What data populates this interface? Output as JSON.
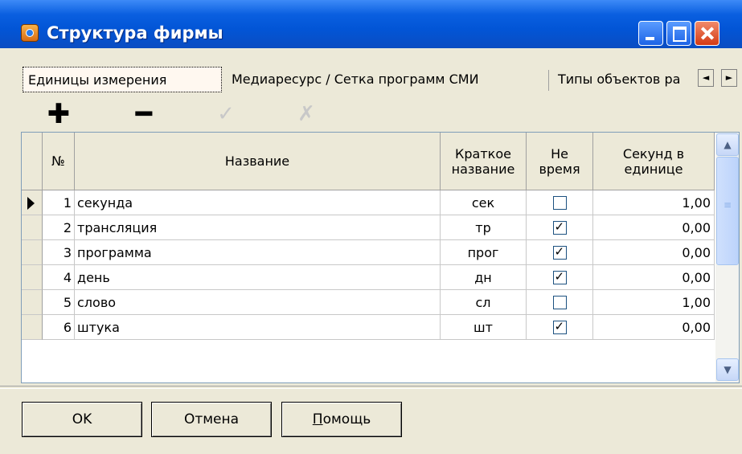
{
  "window": {
    "title": "Структура фирмы",
    "icon": "app-icon",
    "controls": [
      "minimize-icon",
      "maximize-icon",
      "close-icon"
    ]
  },
  "tabs": [
    {
      "label": "Единицы измерения",
      "active": true
    },
    {
      "label": "Медиаресурс / Сетка программ СМИ",
      "active": false
    },
    {
      "label": "Типы объектов ра",
      "active": false
    }
  ],
  "tab_scroll": {
    "left": "◄",
    "right": "►"
  },
  "toolbar": {
    "add": "✚",
    "remove": "━",
    "confirm": "✓",
    "cancel": "✗"
  },
  "grid": {
    "columns": {
      "num": "№",
      "name": "Название",
      "short": "Краткое название",
      "notime": "Не время",
      "seconds": "Секунд в единице"
    },
    "rows": [
      {
        "num": "1",
        "name": "секунда",
        "short": "сек",
        "notime": false,
        "seconds": "1,00"
      },
      {
        "num": "2",
        "name": "трансляция",
        "short": "тр",
        "notime": true,
        "seconds": "0,00"
      },
      {
        "num": "3",
        "name": "программа",
        "short": "прог",
        "notime": true,
        "seconds": "0,00"
      },
      {
        "num": "4",
        "name": "день",
        "short": "дн",
        "notime": true,
        "seconds": "0,00"
      },
      {
        "num": "5",
        "name": "слово",
        "short": "сл",
        "notime": false,
        "seconds": "1,00"
      },
      {
        "num": "6",
        "name": "штука",
        "short": "шт",
        "notime": true,
        "seconds": "0,00"
      }
    ],
    "current_row": 1
  },
  "buttons": {
    "ok": "OK",
    "cancel": "Отмена",
    "help_first": "П",
    "help_rest": "омощь"
  },
  "colors": {
    "titlebar": "#0255d6",
    "face": "#ece9d8"
  }
}
